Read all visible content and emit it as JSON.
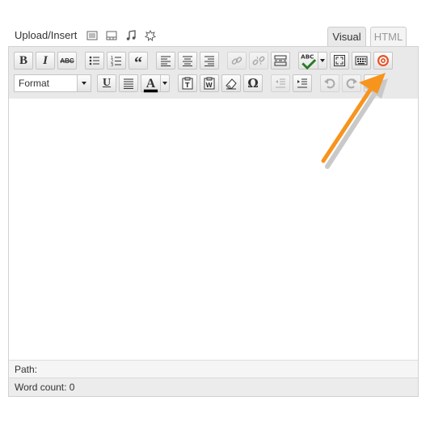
{
  "media": {
    "upload_insert_label": "Upload/Insert",
    "icons": [
      "image-icon",
      "video-icon",
      "audio-icon",
      "media-icon"
    ]
  },
  "tabs": {
    "visual": "Visual",
    "html": "HTML",
    "active": "Visual"
  },
  "toolbar": {
    "row1": [
      "bold",
      "italic",
      "strikethrough",
      "bullet-list",
      "numbered-list",
      "blockquote",
      "align-left",
      "align-center",
      "align-right",
      "insert-link",
      "unlink",
      "insert-more",
      "spellcheck",
      "fullscreen",
      "kitchen-sink",
      "plugin"
    ],
    "row2": [
      "format",
      "underline",
      "justify",
      "text-color",
      "paste-text",
      "paste-word",
      "remove-format",
      "special-character",
      "outdent",
      "indent",
      "undo",
      "redo",
      "help"
    ],
    "bold_glyph": "B",
    "italic_glyph": "I",
    "strike_glyph": "ABC",
    "quote_glyph": "“",
    "underline_glyph": "U",
    "textcolor_glyph": "A",
    "omega_glyph": "Ω",
    "spell_glyph": "ABC",
    "format_value": "Format"
  },
  "status": {
    "path_label": "Path:",
    "word_count": "Word count: 0"
  },
  "colors": {
    "accent_arrow": "#f7941d",
    "plugin_ring": "#e8542a",
    "text_color_swatch": "#000000"
  }
}
